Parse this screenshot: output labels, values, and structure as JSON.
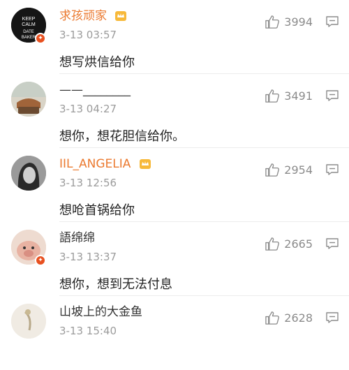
{
  "comments": [
    {
      "username": "求孩顽家",
      "time": "3-13 03:57",
      "text": "想写烘信给你",
      "likes": "3994",
      "name_color": "#eb7a30",
      "verified": true,
      "vip": true
    },
    {
      "username": "——________",
      "time": "3-13 04:27",
      "text": "想你，想花胆信给你。",
      "likes": "3491",
      "name_color": "#333333",
      "verified": false,
      "vip": false
    },
    {
      "username": "IIL_ANGELIA",
      "time": "3-13 12:56",
      "text": "想呛首锅给你",
      "likes": "2954",
      "name_color": "#eb7a30",
      "verified": false,
      "vip": true
    },
    {
      "username": "語绵绵",
      "time": "3-13 13:37",
      "text": "想你，想到无法付息",
      "likes": "2665",
      "name_color": "#333333",
      "verified": true,
      "vip": false
    },
    {
      "username": "山坡上的大金鱼",
      "time": "3-13 15:40",
      "text": "",
      "likes": "2628",
      "name_color": "#333333",
      "verified": false,
      "vip": false
    }
  ],
  "avatar_logo_lines": [
    "KEEP",
    "CALM",
    "DATE",
    "BAKER"
  ],
  "icons": {
    "like": "thumbs-up-icon",
    "reply": "comment-icon",
    "vip": "vip-crown-icon",
    "verified": "verified-badge-icon"
  }
}
